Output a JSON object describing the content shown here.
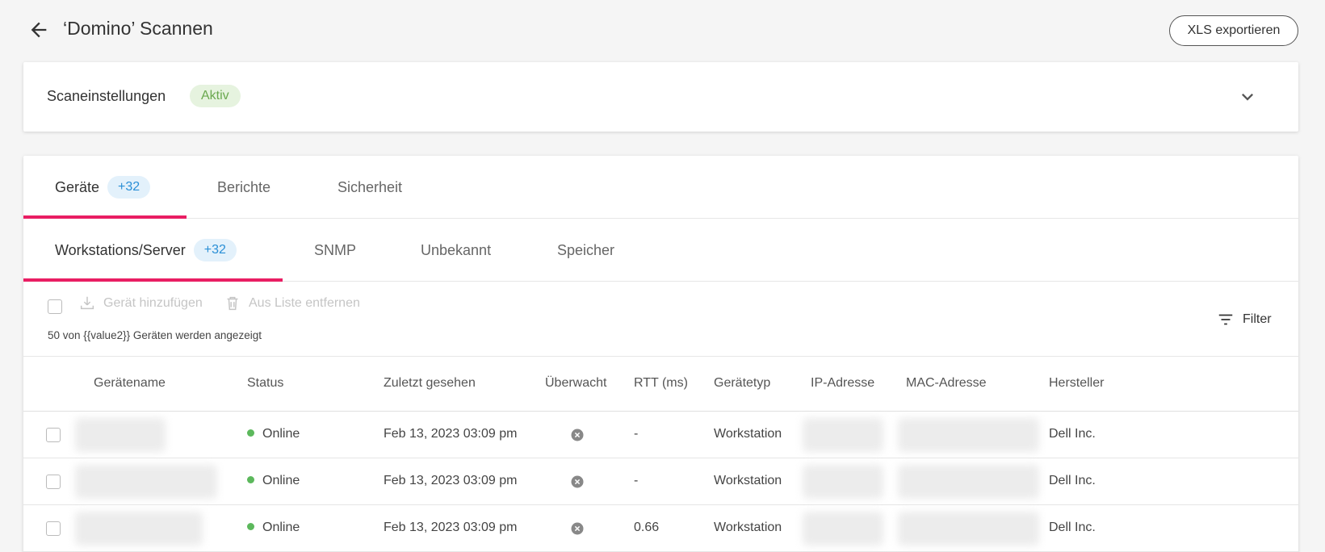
{
  "header": {
    "title": "‘Domino’ Scannen",
    "export_label": "XLS exportieren"
  },
  "settings": {
    "title": "Scaneinstellungen",
    "status_badge": "Aktiv"
  },
  "tabs": [
    {
      "label": "Geräte",
      "badge": "+32",
      "active": true
    },
    {
      "label": "Berichte"
    },
    {
      "label": "Sicherheit"
    }
  ],
  "subtabs": [
    {
      "label": "Workstations/Server",
      "badge": "+32",
      "active": true
    },
    {
      "label": "SNMP"
    },
    {
      "label": "Unbekannt"
    },
    {
      "label": "Speicher"
    }
  ],
  "toolbar": {
    "add_device": "Gerät hinzufügen",
    "remove_from_list": "Aus Liste entfernen",
    "count_text": "50 von {{value2}} Geräten werden angezeigt",
    "filter_label": "Filter"
  },
  "table": {
    "columns": [
      "Gerätename",
      "Status",
      "Zuletzt gesehen",
      "Überwacht",
      "RTT (ms)",
      "Gerätetyp",
      "IP-Adresse",
      "MAC-Adresse",
      "Hersteller"
    ],
    "rows": [
      {
        "status": "Online",
        "last_seen": "Feb 13, 2023 03:09 pm",
        "rtt": "-",
        "type": "Workstation",
        "vendor": "Dell Inc."
      },
      {
        "status": "Online",
        "last_seen": "Feb 13, 2023 03:09 pm",
        "rtt": "-",
        "type": "Workstation",
        "vendor": "Dell Inc."
      },
      {
        "status": "Online",
        "last_seen": "Feb 13, 2023 03:09 pm",
        "rtt": "0.66",
        "type": "Workstation",
        "vendor": "Dell Inc."
      }
    ]
  },
  "icons": {
    "back": "arrow-left-icon",
    "chevron": "chevron-down-icon",
    "download": "download-icon",
    "trash": "trash-icon",
    "filter": "filter-icon",
    "not_monitored": "x-circle-icon"
  },
  "colors": {
    "accent": "#e91e63",
    "badge_blue_bg": "#e3f1fb",
    "badge_blue_text": "#2a8fd6",
    "badge_green_bg": "#e6f3df",
    "badge_green_text": "#6aa84f",
    "online": "#5cb85c"
  }
}
